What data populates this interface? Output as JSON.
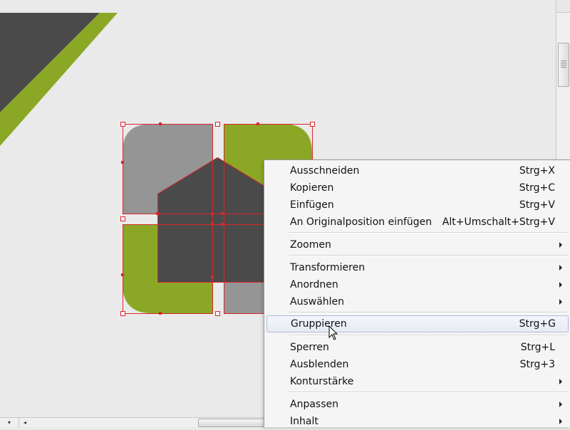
{
  "canvas": {
    "colors": {
      "background": "#eaeaea",
      "dark_gray": "#4a4a4a",
      "light_gray": "#959595",
      "green": "#8aa825",
      "selection_red": "#d9262c"
    },
    "selection_handles": 12
  },
  "context_menu": {
    "items": [
      {
        "label": "Ausschneiden",
        "shortcut": "Strg+X"
      },
      {
        "label": "Kopieren",
        "shortcut": "Strg+C"
      },
      {
        "label": "Einfügen",
        "shortcut": "Strg+V"
      },
      {
        "label": "An Originalposition einfügen",
        "shortcut": "Alt+Umschalt+Strg+V"
      },
      {
        "label": "Zoomen",
        "submenu": true
      },
      {
        "label": "Transformieren",
        "submenu": true
      },
      {
        "label": "Anordnen",
        "submenu": true
      },
      {
        "label": "Auswählen",
        "submenu": true
      },
      {
        "label": "Gruppieren",
        "shortcut": "Strg+G",
        "highlighted": true
      },
      {
        "label": "Sperren",
        "shortcut": "Strg+L"
      },
      {
        "label": "Ausblenden",
        "shortcut": "Strg+3"
      },
      {
        "label": "Konturstärke",
        "submenu": true
      },
      {
        "label": "Anpassen",
        "submenu": true
      },
      {
        "label": "Inhalt",
        "submenu": true
      }
    ]
  },
  "icons": {
    "submenu": "chevron-right-icon",
    "cursor": "mouse-pointer-icon",
    "scroll_dropdown": "caret-down-icon",
    "scroll_left": "caret-left-icon"
  },
  "glyphs": {
    "caret_down": "▾",
    "caret_left": "◂"
  }
}
